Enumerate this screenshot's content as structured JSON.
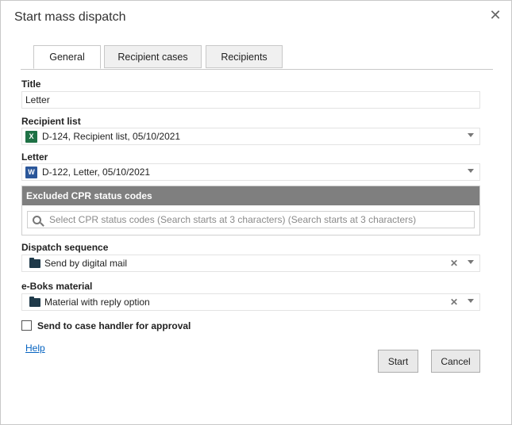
{
  "dialog": {
    "title": "Start mass dispatch"
  },
  "tabs": [
    {
      "label": "General",
      "active": true
    },
    {
      "label": "Recipient cases",
      "active": false
    },
    {
      "label": "Recipients",
      "active": false
    }
  ],
  "fields": {
    "title": {
      "label": "Title",
      "value": "Letter"
    },
    "recipient_list": {
      "label": "Recipient list",
      "value": "D-124, Recipient list, 05/10/2021",
      "icon": "excel-icon",
      "icon_glyph": "X"
    },
    "letter": {
      "label": "Letter",
      "value": "D-122, Letter, 05/10/2021",
      "icon": "word-icon",
      "icon_glyph": "W"
    },
    "excluded_cpr": {
      "header": "Excluded CPR status codes",
      "placeholder": "Select CPR status codes (Search starts at 3 characters) (Search starts at 3 characters)"
    },
    "dispatch_sequence": {
      "label": "Dispatch sequence",
      "value": "Send by digital mail",
      "icon": "folder-icon"
    },
    "eboks_material": {
      "label": "e-Boks material",
      "value": "Material with reply option",
      "icon": "folder-icon"
    }
  },
  "approval": {
    "label": "Send to case handler for approval",
    "checked": false
  },
  "footer": {
    "help_label": "Help",
    "start_label": "Start",
    "cancel_label": "Cancel"
  },
  "colors": {
    "section_header": "#7f7f7f",
    "link": "#0563c1",
    "excel": "#1e7145",
    "word": "#2b579a",
    "folder": "#1f3a4a"
  }
}
